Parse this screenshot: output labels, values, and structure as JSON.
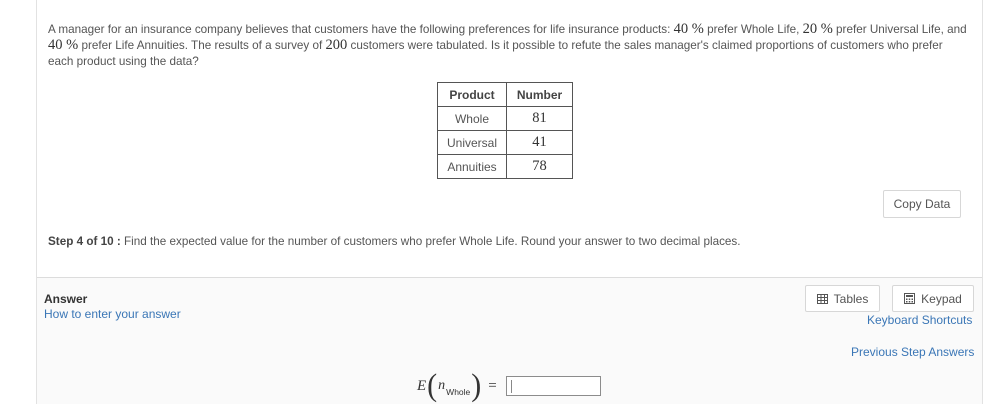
{
  "question": {
    "p1": "A manager for an insurance company believes that customers have the following preferences for life insurance products: ",
    "pct_whole": "40 %",
    "p2": " prefer Whole Life, ",
    "pct_universal": "20 %",
    "p3": " prefer Universal Life, and ",
    "pct_annuities": "40 %",
    "p4": " prefer Life Annuities.  The results of a survey of ",
    "n_customers": "200",
    "p5": " customers were tabulated.  Is it possible to refute the sales manager's claimed proportions of customers who prefer each product using the data?"
  },
  "table": {
    "headers": [
      "Product",
      "Number"
    ],
    "rows": [
      [
        "Whole",
        "81"
      ],
      [
        "Universal",
        "41"
      ],
      [
        "Annuities",
        "78"
      ]
    ]
  },
  "copy_data_label": "Copy Data",
  "step": {
    "label": "Step 4 of 10 :",
    "text": "Find the expected value for the number of customers who prefer Whole Life. Round your answer to two decimal places."
  },
  "answer": {
    "title": "Answer",
    "how_link": "How to enter your answer",
    "tables_label": "Tables",
    "keypad_label": "Keypad",
    "keyboard_shortcuts": "Keyboard Shortcuts",
    "previous_step_answers": "Previous Step Answers",
    "expression": {
      "E": "E",
      "open_paren": "(",
      "n": "n",
      "subscript": "Whole",
      "close_paren": ")",
      "equals": "=",
      "value": ""
    }
  },
  "icons": {
    "tables": "table-grid-icon",
    "keypad": "calculator-icon"
  }
}
